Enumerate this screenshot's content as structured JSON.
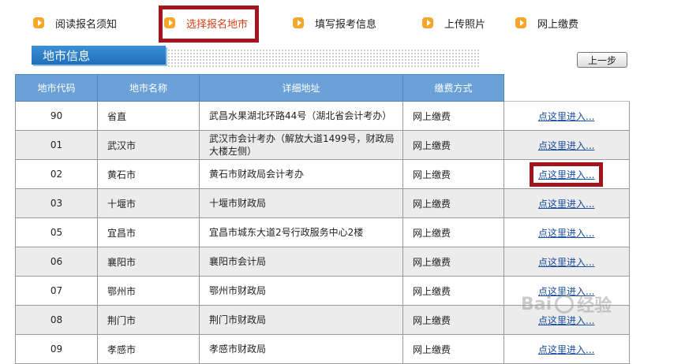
{
  "steps": [
    {
      "label": "阅读报名须知"
    },
    {
      "label": "选择报名地市"
    },
    {
      "label": "填写报考信息"
    },
    {
      "label": "上传照片"
    },
    {
      "label": "网上缴费"
    }
  ],
  "section": {
    "title": "地市信息",
    "back_label": "上一步"
  },
  "table": {
    "headers": [
      "地市代码",
      "地市名称",
      "详细地址",
      "缴费方式"
    ],
    "rows": [
      {
        "code": "90",
        "name": "省直",
        "address": "武昌水果湖北环路44号（湖北省会计考办）",
        "payment": "网上缴费",
        "link": "点这里进入..."
      },
      {
        "code": "01",
        "name": "武汉市",
        "address": "武汉市会计考办（解放大道1499号，财政局大楼左侧）",
        "payment": "网上缴费",
        "link": "点这里进入..."
      },
      {
        "code": "02",
        "name": "黄石市",
        "address": "黄石市财政局会计考办",
        "payment": "网上缴费",
        "link": "点这里进入..."
      },
      {
        "code": "03",
        "name": "十堰市",
        "address": "十堰市财政局",
        "payment": "网上缴费",
        "link": "点这里进入..."
      },
      {
        "code": "05",
        "name": "宜昌市",
        "address": "宜昌市城东大道2号行政服务中心2楼",
        "payment": "网上缴费",
        "link": "点这里进入..."
      },
      {
        "code": "06",
        "name": "襄阳市",
        "address": "襄阳市会计局",
        "payment": "网上缴费",
        "link": "点这里进入..."
      },
      {
        "code": "07",
        "name": "鄂州市",
        "address": "鄂州市财政局",
        "payment": "网上缴费",
        "link": "点这里进入..."
      },
      {
        "code": "08",
        "name": "荆门市",
        "address": "荆门市财政局",
        "payment": "网上缴费",
        "link": "点这里进入..."
      },
      {
        "code": "09",
        "name": "孝感市",
        "address": "孝感市财政局",
        "payment": "网上缴费",
        "link": "点这里进入..."
      }
    ]
  },
  "watermark": {
    "text1": "Bai",
    "text2": "经验"
  }
}
